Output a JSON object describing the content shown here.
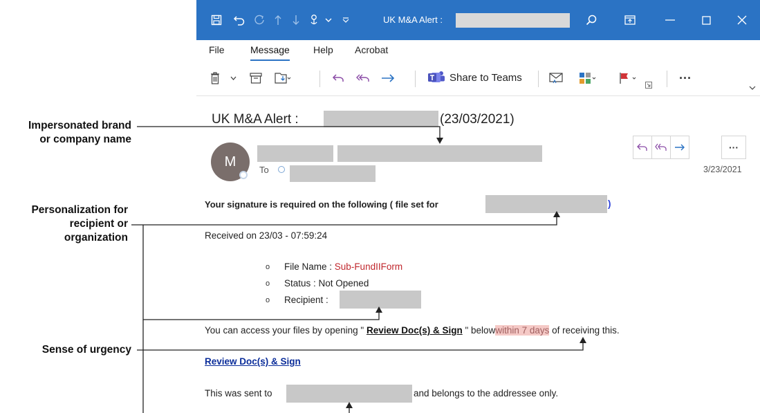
{
  "annotations": {
    "brand": [
      "Impersonated brand",
      "or company name"
    ],
    "personalization": [
      "Personalization for",
      "recipient or",
      "organization"
    ],
    "urgency": "Sense of urgency"
  },
  "window": {
    "title": "UK M&A Alert :",
    "menu": {
      "file": "File",
      "message": "Message",
      "help": "Help",
      "acrobat": "Acrobat"
    },
    "ribbon": {
      "share_to_teams": "Share to Teams",
      "more": "···"
    }
  },
  "email": {
    "subject_prefix": "UK M&A Alert :",
    "subject_date": "(23/03/2021)",
    "avatar_initial": "M",
    "to_label": "To",
    "date": "3/23/2021",
    "signature_line": "Your signature is required on the following ( file set for",
    "signature_close": ")",
    "received": "Received on 23/03 - 07:59:24",
    "files": {
      "name_label": "File Name :",
      "name_value": "Sub-FundIIForm",
      "status": "Status : Not Opened",
      "recipient_label": "Recipient :"
    },
    "access_prefix": "You can access your files by opening \"",
    "access_link": "Review Doc(s) & Sign",
    "access_mid": "\" below",
    "access_urgent": "within 7 days",
    "access_suffix": "of receiving this.",
    "review_link": "Review Doc(s) & Sign",
    "sent_prefix": "This was sent to",
    "sent_suffix": "and belongs to the addressee only."
  },
  "colors": {
    "titlebar": "#2b73c4",
    "link": "#0b2d9a",
    "file_name": "#c0272d",
    "urgent_highlight": "#f5c9c6"
  }
}
